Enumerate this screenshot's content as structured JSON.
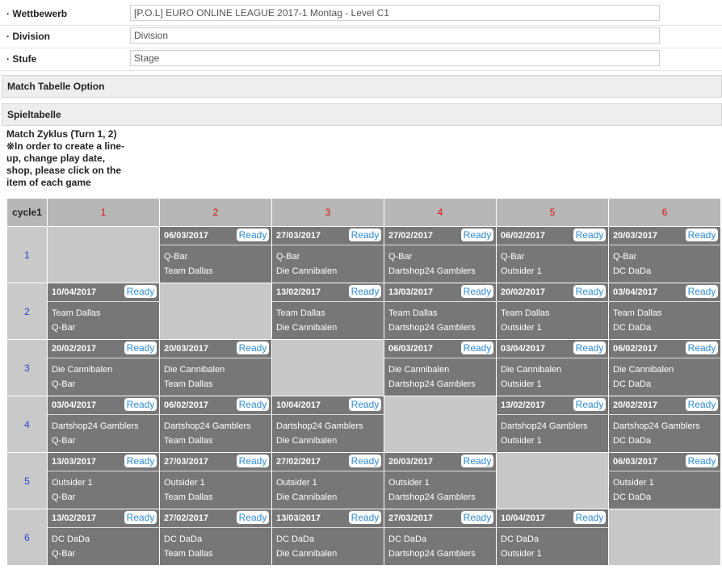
{
  "form": {
    "competition_label": "· Wettbewerb",
    "competition_value": "[P.O.L] EURO ONLINE LEAGUE 2017-1 Montag - Level C1",
    "division_label": "· Division",
    "division_placeholder": "Division",
    "stage_label": "· Stufe",
    "stage_placeholder": "Stage"
  },
  "sections": {
    "match_table_option": "Match Tabelle Option",
    "game_table": "Spieltabelle"
  },
  "info": {
    "cycle_title": "Match Zyklus (Turn 1, 2)",
    "instructions": "※In order to create a line-up, change play date, shop, please click on the item of each game"
  },
  "grid": {
    "corner": "cycle1",
    "ready_label": "Ready",
    "columns": [
      "1",
      "2",
      "3",
      "4",
      "5",
      "6"
    ],
    "rows": [
      {
        "label": "1",
        "cells": [
          null,
          {
            "date": "06/03/2017",
            "home": "Q-Bar",
            "away": "Team Dallas"
          },
          {
            "date": "27/03/2017",
            "home": "Q-Bar",
            "away": "Die Cannibalen"
          },
          {
            "date": "27/02/2017",
            "home": "Q-Bar",
            "away": "Dartshop24 Gamblers"
          },
          {
            "date": "06/02/2017",
            "home": "Q-Bar",
            "away": "Outsider 1"
          },
          {
            "date": "20/03/2017",
            "home": "Q-Bar",
            "away": "DC DaDa"
          }
        ]
      },
      {
        "label": "2",
        "cells": [
          {
            "date": "10/04/2017",
            "home": "Team Dallas",
            "away": "Q-Bar"
          },
          null,
          {
            "date": "13/02/2017",
            "home": "Team Dallas",
            "away": "Die Cannibalen"
          },
          {
            "date": "13/03/2017",
            "home": "Team Dallas",
            "away": "Dartshop24 Gamblers"
          },
          {
            "date": "20/02/2017",
            "home": "Team Dallas",
            "away": "Outsider 1"
          },
          {
            "date": "03/04/2017",
            "home": "Team Dallas",
            "away": "DC DaDa"
          }
        ]
      },
      {
        "label": "3",
        "cells": [
          {
            "date": "20/02/2017",
            "home": "Die Cannibalen",
            "away": "Q-Bar"
          },
          {
            "date": "20/03/2017",
            "home": "Die Cannibalen",
            "away": "Team Dallas"
          },
          null,
          {
            "date": "06/03/2017",
            "home": "Die Cannibalen",
            "away": "Dartshop24 Gamblers"
          },
          {
            "date": "03/04/2017",
            "home": "Die Cannibalen",
            "away": "Outsider 1"
          },
          {
            "date": "06/02/2017",
            "home": "Die Cannibalen",
            "away": "DC DaDa"
          }
        ]
      },
      {
        "label": "4",
        "cells": [
          {
            "date": "03/04/2017",
            "home": "Dartshop24 Gamblers",
            "away": "Q-Bar"
          },
          {
            "date": "06/02/2017",
            "home": "Dartshop24 Gamblers",
            "away": "Team Dallas"
          },
          {
            "date": "10/04/2017",
            "home": "Dartshop24 Gamblers",
            "away": "Die Cannibalen"
          },
          null,
          {
            "date": "13/02/2017",
            "home": "Dartshop24 Gamblers",
            "away": "Outsider 1"
          },
          {
            "date": "20/02/2017",
            "home": "Dartshop24 Gamblers",
            "away": "DC DaDa"
          }
        ]
      },
      {
        "label": "5",
        "cells": [
          {
            "date": "13/03/2017",
            "home": "Outsider 1",
            "away": "Q-Bar"
          },
          {
            "date": "27/03/2017",
            "home": "Outsider 1",
            "away": "Team Dallas"
          },
          {
            "date": "27/02/2017",
            "home": "Outsider 1",
            "away": "Die Cannibalen"
          },
          {
            "date": "20/03/2017",
            "home": "Outsider 1",
            "away": "Dartshop24 Gamblers"
          },
          null,
          {
            "date": "06/03/2017",
            "home": "Outsider 1",
            "away": "DC DaDa"
          }
        ]
      },
      {
        "label": "6",
        "cells": [
          {
            "date": "13/02/2017",
            "home": "DC DaDa",
            "away": "Q-Bar"
          },
          {
            "date": "27/02/2017",
            "home": "DC DaDa",
            "away": "Team Dallas"
          },
          {
            "date": "13/03/2017",
            "home": "DC DaDa",
            "away": "Die Cannibalen"
          },
          {
            "date": "27/03/2017",
            "home": "DC DaDa",
            "away": "Dartshop24 Gamblers"
          },
          {
            "date": "10/04/2017",
            "home": "DC DaDa",
            "away": "Outsider 1"
          },
          null
        ]
      }
    ]
  }
}
